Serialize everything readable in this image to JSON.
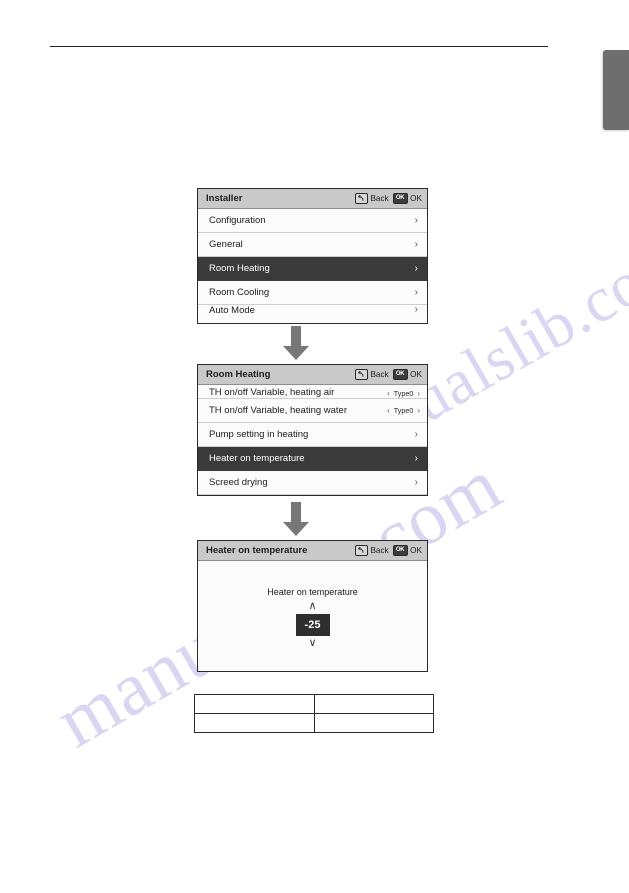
{
  "page": {
    "watermark_text": "manualslib.com",
    "rule_color": "#231f20",
    "edge_tab_color": "#6e6e6e"
  },
  "common": {
    "back_label": "Back",
    "ok_label": "OK",
    "back_icon": "back-arrow-icon",
    "ok_icon": "ok-key-icon",
    "chevron_right": "›",
    "chevron_left_small": "‹",
    "chevron_right_small": "›",
    "arrow_up": "∧",
    "arrow_down": "∨"
  },
  "screens": [
    {
      "id": "installer",
      "title": "Installer",
      "rows": [
        {
          "label": "Configuration",
          "selected": false,
          "control": "chevron",
          "clip": "none"
        },
        {
          "label": "General",
          "selected": false,
          "control": "chevron",
          "clip": "none"
        },
        {
          "label": "Room Heating",
          "selected": true,
          "control": "chevron",
          "clip": "none"
        },
        {
          "label": "Room Cooling",
          "selected": false,
          "control": "chevron",
          "clip": "none"
        },
        {
          "label": "Auto Mode",
          "selected": false,
          "control": "chevron",
          "clip": "bottom"
        }
      ]
    },
    {
      "id": "room-heating",
      "title": "Room Heating",
      "rows": [
        {
          "label": "TH on/off Variable, heating air",
          "selected": false,
          "control": "value",
          "value": "Type0",
          "clip": "top"
        },
        {
          "label": "TH on/off Variable, heating water",
          "selected": false,
          "control": "value",
          "value": "Type0",
          "clip": "none"
        },
        {
          "label": "Pump setting in heating",
          "selected": false,
          "control": "chevron",
          "clip": "none"
        },
        {
          "label": "Heater on temperature",
          "selected": true,
          "control": "chevron",
          "clip": "none"
        },
        {
          "label": "Screed drying",
          "selected": false,
          "control": "chevron",
          "clip": "none"
        }
      ]
    },
    {
      "id": "heater-on-temperature",
      "title": "Heater on temperature",
      "stepper": {
        "caption": "Heater on temperature",
        "value": "-25"
      }
    }
  ],
  "bottom_table": {
    "rows": [
      {
        "left": "",
        "right": ""
      },
      {
        "left": "",
        "right": ""
      }
    ]
  }
}
